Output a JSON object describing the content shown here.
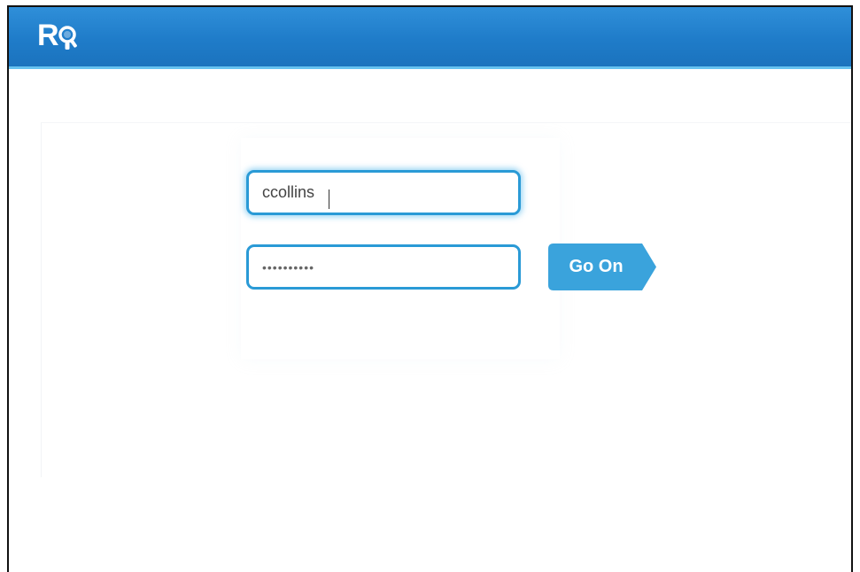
{
  "app": {
    "logo_text": "R"
  },
  "login": {
    "username_value": "ccollins",
    "password_value": "••••••••••",
    "submit_label": "Go On"
  },
  "colors": {
    "header": "#1f7cc9",
    "header_border": "#66c2f0",
    "field_border": "#2a9ad6",
    "button": "#3aa3dc"
  },
  "icons": {
    "logo": "magnifier-logo-icon"
  }
}
